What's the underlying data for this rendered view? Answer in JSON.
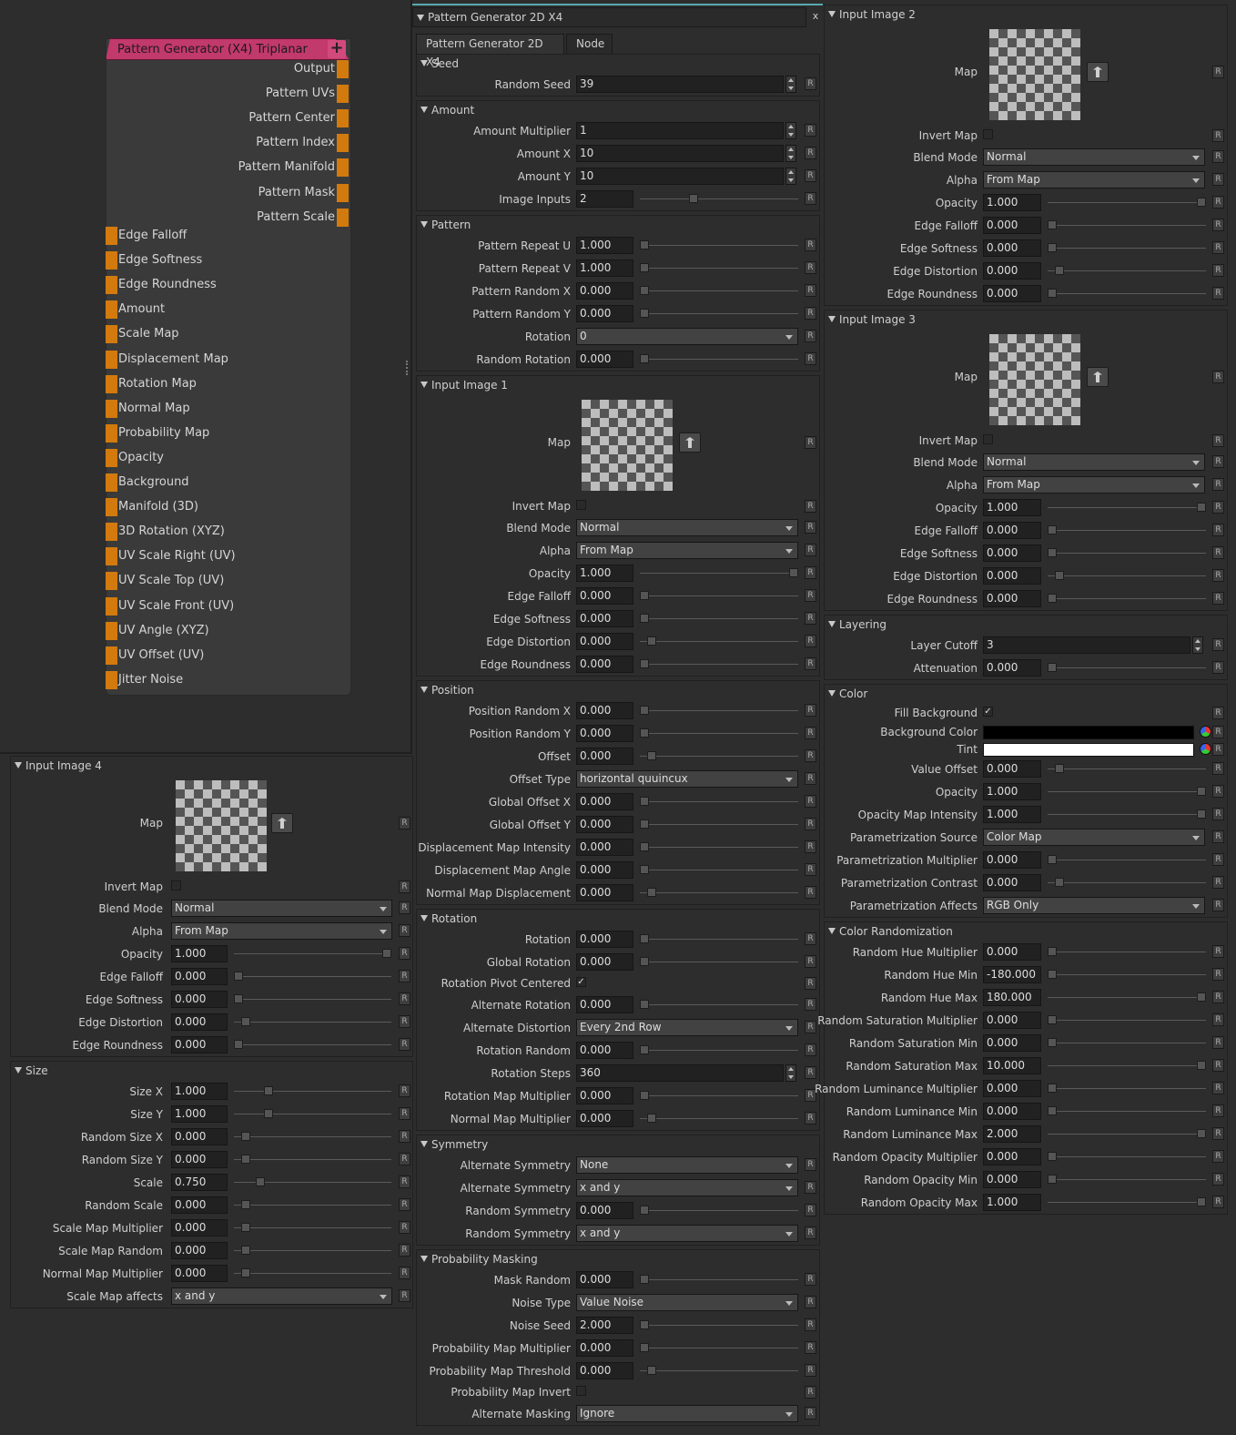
{
  "node": {
    "title": "Pattern Generator (X4) Triplanar",
    "add_label": "+",
    "outputs": [
      "Output",
      "Pattern UVs",
      "Pattern Center",
      "Pattern Index",
      "Pattern Manifold",
      "Pattern Mask",
      "Pattern Scale"
    ],
    "inputs": [
      "Edge Falloff",
      "Edge Softness",
      "Edge Roundness",
      "Amount",
      "Scale Map",
      "Displacement Map",
      "Rotation Map",
      "Normal Map",
      "Probability Map",
      "Opacity",
      "Background",
      "Manifold (3D)",
      "3D Rotation (XYZ)",
      "UV Scale Right (UV)",
      "UV Scale Top (UV)",
      "UV Scale Front (UV)",
      "UV Angle (XYZ)",
      "UV Offset (UV)",
      "Jitter Noise"
    ]
  },
  "panel": {
    "title": "Pattern Generator 2D X4",
    "close": "x",
    "tabs": [
      "Pattern Generator 2D X4",
      "Node"
    ],
    "reset": "R"
  },
  "col_left": [
    {
      "title": "Input Image 4",
      "rows": [
        {
          "t": "map",
          "label": "Map"
        },
        {
          "t": "chk",
          "label": "Invert Map",
          "checked": false
        },
        {
          "t": "dd",
          "label": "Blend Mode",
          "value": "Normal"
        },
        {
          "t": "dd",
          "label": "Alpha",
          "value": "From Map"
        },
        {
          "t": "sl",
          "label": "Opacity",
          "value": "1.000",
          "pos": 1
        },
        {
          "t": "sl",
          "label": "Edge Falloff",
          "value": "0.000",
          "pos": 0
        },
        {
          "t": "sl",
          "label": "Edge Softness",
          "value": "0.000",
          "pos": 0
        },
        {
          "t": "sl",
          "label": "Edge Distortion",
          "value": "0.000",
          "pos": 0.5,
          "center": true
        },
        {
          "t": "sl",
          "label": "Edge Roundness",
          "value": "0.000",
          "pos": 0
        }
      ]
    },
    {
      "title": "Size",
      "rows": [
        {
          "t": "sl",
          "label": "Size X",
          "value": "1.000",
          "pos": 0.2
        },
        {
          "t": "sl",
          "label": "Size Y",
          "value": "1.000",
          "pos": 0.2
        },
        {
          "t": "sl",
          "label": "Random Size X",
          "value": "0.000",
          "pos": 0.5,
          "center": true
        },
        {
          "t": "sl",
          "label": "Random Size Y",
          "value": "0.000",
          "pos": 0.5,
          "center": true
        },
        {
          "t": "sl",
          "label": "Scale",
          "value": "0.750",
          "pos": 0.15
        },
        {
          "t": "sl",
          "label": "Random Scale",
          "value": "0.000",
          "pos": 0.5,
          "center": true
        },
        {
          "t": "sl",
          "label": "Scale Map Multiplier",
          "value": "0.000",
          "pos": 0.5,
          "center": true
        },
        {
          "t": "sl",
          "label": "Scale Map Random",
          "value": "0.000",
          "pos": 0.5,
          "center": true
        },
        {
          "t": "sl",
          "label": "Normal Map Multiplier",
          "value": "0.000",
          "pos": 0.5,
          "center": true
        },
        {
          "t": "dd",
          "label": "Scale Map affects",
          "value": "x and y"
        }
      ]
    }
  ],
  "col_mid": [
    {
      "title": "Seed",
      "rows": [
        {
          "t": "num",
          "label": "Random Seed",
          "value": "39"
        }
      ]
    },
    {
      "title": "Amount",
      "rows": [
        {
          "t": "num",
          "label": "Amount Multiplier",
          "value": "1"
        },
        {
          "t": "num",
          "label": "Amount X",
          "value": "10"
        },
        {
          "t": "num",
          "label": "Amount Y",
          "value": "10"
        },
        {
          "t": "sl",
          "label": "Image Inputs",
          "value": "2",
          "pos": 0.33
        }
      ]
    },
    {
      "title": "Pattern",
      "rows": [
        {
          "t": "sl",
          "label": "Pattern Repeat U",
          "value": "1.000",
          "pos": 0
        },
        {
          "t": "sl",
          "label": "Pattern Repeat V",
          "value": "1.000",
          "pos": 0
        },
        {
          "t": "sl",
          "label": "Pattern Random X",
          "value": "0.000",
          "pos": 0
        },
        {
          "t": "sl",
          "label": "Pattern Random Y",
          "value": "0.000",
          "pos": 0
        },
        {
          "t": "dd",
          "label": "Rotation",
          "value": "0"
        },
        {
          "t": "sl",
          "label": "Random Rotation",
          "value": "0.000",
          "pos": 0
        }
      ]
    },
    {
      "title": "Input Image 1",
      "rows": [
        {
          "t": "map",
          "label": "Map"
        },
        {
          "t": "chk",
          "label": "Invert Map",
          "checked": false
        },
        {
          "t": "dd",
          "label": "Blend Mode",
          "value": "Normal"
        },
        {
          "t": "dd",
          "label": "Alpha",
          "value": "From Map"
        },
        {
          "t": "sl",
          "label": "Opacity",
          "value": "1.000",
          "pos": 1
        },
        {
          "t": "sl",
          "label": "Edge Falloff",
          "value": "0.000",
          "pos": 0
        },
        {
          "t": "sl",
          "label": "Edge Softness",
          "value": "0.000",
          "pos": 0
        },
        {
          "t": "sl",
          "label": "Edge Distortion",
          "value": "0.000",
          "pos": 0.5,
          "center": true
        },
        {
          "t": "sl",
          "label": "Edge Roundness",
          "value": "0.000",
          "pos": 0
        }
      ]
    },
    {
      "title": "Position",
      "rows": [
        {
          "t": "sl",
          "label": "Position Random X",
          "value": "0.000",
          "pos": 0
        },
        {
          "t": "sl",
          "label": "Position Random Y",
          "value": "0.000",
          "pos": 0
        },
        {
          "t": "sl",
          "label": "Offset",
          "value": "0.000",
          "pos": 0.5,
          "center": true
        },
        {
          "t": "dd",
          "label": "Offset Type",
          "value": "horizontal quuincux"
        },
        {
          "t": "sl",
          "label": "Global Offset X",
          "value": "0.000",
          "pos": 0
        },
        {
          "t": "sl",
          "label": "Global Offset Y",
          "value": "0.000",
          "pos": 0
        },
        {
          "t": "sl",
          "label": "Displacement Map Intensity",
          "value": "0.000",
          "pos": 0
        },
        {
          "t": "sl",
          "label": "Displacement Map Angle",
          "value": "0.000",
          "pos": 0
        },
        {
          "t": "sl",
          "label": "Normal Map Displacement",
          "value": "0.000",
          "pos": 0.5,
          "center": true
        }
      ]
    },
    {
      "title": "Rotation",
      "rows": [
        {
          "t": "sl",
          "label": "Rotation",
          "value": "0.000",
          "pos": 0
        },
        {
          "t": "sl",
          "label": "Global Rotation",
          "value": "0.000",
          "pos": 0
        },
        {
          "t": "chk",
          "label": "Rotation Pivot Centered",
          "checked": true
        },
        {
          "t": "sl",
          "label": "Alternate Rotation",
          "value": "0.000",
          "pos": 0
        },
        {
          "t": "dd",
          "label": "Alternate Distortion",
          "value": "Every 2nd Row"
        },
        {
          "t": "sl",
          "label": "Rotation Random",
          "value": "0.000",
          "pos": 0
        },
        {
          "t": "num",
          "label": "Rotation Steps",
          "value": "360"
        },
        {
          "t": "sl",
          "label": "Rotation Map Multiplier",
          "value": "0.000",
          "pos": 0
        },
        {
          "t": "sl",
          "label": "Normal Map Multiplier",
          "value": "0.000",
          "pos": 0.5,
          "center": true
        }
      ]
    },
    {
      "title": "Symmetry",
      "rows": [
        {
          "t": "dd",
          "label": "Alternate Symmetry",
          "value": "None"
        },
        {
          "t": "dd",
          "label": "Alternate Symmetry",
          "value": "x and y"
        },
        {
          "t": "sl",
          "label": "Random Symmetry",
          "value": "0.000",
          "pos": 0
        },
        {
          "t": "dd",
          "label": "Random Symmetry",
          "value": "x and y"
        }
      ]
    },
    {
      "title": "Probability Masking",
      "rows": [
        {
          "t": "sl",
          "label": "Mask Random",
          "value": "0.000",
          "pos": 0
        },
        {
          "t": "dd",
          "label": "Noise Type",
          "value": "Value Noise"
        },
        {
          "t": "sl",
          "label": "Noise Seed",
          "value": "2.000",
          "pos": 0
        },
        {
          "t": "sl",
          "label": "Probability Map Multiplier",
          "value": "0.000",
          "pos": 0
        },
        {
          "t": "sl",
          "label": "Probability Map Threshold",
          "value": "0.000",
          "pos": 0.5,
          "center": true
        },
        {
          "t": "chk",
          "label": "Probability Map Invert",
          "checked": false
        },
        {
          "t": "dd",
          "label": "Alternate Masking",
          "value": "Ignore"
        }
      ]
    }
  ],
  "col_right": [
    {
      "title": "Input Image 2",
      "rows": [
        {
          "t": "map",
          "label": "Map"
        },
        {
          "t": "chk",
          "label": "Invert Map",
          "checked": false
        },
        {
          "t": "dd",
          "label": "Blend Mode",
          "value": "Normal"
        },
        {
          "t": "dd",
          "label": "Alpha",
          "value": "From Map"
        },
        {
          "t": "sl",
          "label": "Opacity",
          "value": "1.000",
          "pos": 1
        },
        {
          "t": "sl",
          "label": "Edge Falloff",
          "value": "0.000",
          "pos": 0
        },
        {
          "t": "sl",
          "label": "Edge Softness",
          "value": "0.000",
          "pos": 0
        },
        {
          "t": "sl",
          "label": "Edge Distortion",
          "value": "0.000",
          "pos": 0.5,
          "center": true
        },
        {
          "t": "sl",
          "label": "Edge Roundness",
          "value": "0.000",
          "pos": 0
        }
      ]
    },
    {
      "title": "Input Image 3",
      "rows": [
        {
          "t": "map",
          "label": "Map"
        },
        {
          "t": "chk",
          "label": "Invert Map",
          "checked": false
        },
        {
          "t": "dd",
          "label": "Blend Mode",
          "value": "Normal"
        },
        {
          "t": "dd",
          "label": "Alpha",
          "value": "From Map"
        },
        {
          "t": "sl",
          "label": "Opacity",
          "value": "1.000",
          "pos": 1
        },
        {
          "t": "sl",
          "label": "Edge Falloff",
          "value": "0.000",
          "pos": 0
        },
        {
          "t": "sl",
          "label": "Edge Softness",
          "value": "0.000",
          "pos": 0
        },
        {
          "t": "sl",
          "label": "Edge Distortion",
          "value": "0.000",
          "pos": 0.5,
          "center": true
        },
        {
          "t": "sl",
          "label": "Edge Roundness",
          "value": "0.000",
          "pos": 0
        }
      ]
    },
    {
      "title": "Layering",
      "rows": [
        {
          "t": "num",
          "label": "Layer Cutoff",
          "value": "3"
        },
        {
          "t": "sl",
          "label": "Attenuation",
          "value": "0.000",
          "pos": 0
        }
      ]
    },
    {
      "title": "Color",
      "rows": [
        {
          "t": "chk",
          "label": "Fill Background",
          "checked": true,
          "short": true
        },
        {
          "t": "color",
          "label": "Background Color",
          "color": "#000000"
        },
        {
          "t": "color",
          "label": "Tint",
          "color": "#ffffff"
        },
        {
          "t": "sl",
          "label": "Value Offset",
          "value": "0.000",
          "pos": 0.5,
          "center": true
        },
        {
          "t": "sl",
          "label": "Opacity",
          "value": "1.000",
          "pos": 1
        },
        {
          "t": "sl",
          "label": "Opacity Map Intensity",
          "value": "1.000",
          "pos": 1
        },
        {
          "t": "dd",
          "label": "Parametrization Source",
          "value": "Color Map"
        },
        {
          "t": "sl",
          "label": "Parametrization Multiplier",
          "value": "0.000",
          "pos": 0
        },
        {
          "t": "sl",
          "label": "Parametrization Contrast",
          "value": "0.000",
          "pos": 0.5,
          "center": true
        },
        {
          "t": "dd",
          "label": "Parametrization Affects",
          "value": "RGB Only"
        }
      ]
    },
    {
      "title": "Color Randomization",
      "rows": [
        {
          "t": "sl",
          "label": "Random Hue Multiplier",
          "value": "0.000",
          "pos": 0
        },
        {
          "t": "sl",
          "label": "Random Hue Min",
          "value": "-180.000",
          "pos": 0
        },
        {
          "t": "sl",
          "label": "Random Hue Max",
          "value": "180.000",
          "pos": 1
        },
        {
          "t": "sl",
          "label": "Random Saturation Multiplier",
          "value": "0.000",
          "pos": 0
        },
        {
          "t": "sl",
          "label": "Random Saturation Min",
          "value": "0.000",
          "pos": 0
        },
        {
          "t": "sl",
          "label": "Random Saturation Max",
          "value": "10.000",
          "pos": 1
        },
        {
          "t": "sl",
          "label": "Random Luminance Multiplier",
          "value": "0.000",
          "pos": 0
        },
        {
          "t": "sl",
          "label": "Random Luminance Min",
          "value": "0.000",
          "pos": 0
        },
        {
          "t": "sl",
          "label": "Random Luminance Max",
          "value": "2.000",
          "pos": 1
        },
        {
          "t": "sl",
          "label": "Random Opacity Multiplier",
          "value": "0.000",
          "pos": 0
        },
        {
          "t": "sl",
          "label": "Random Opacity Min",
          "value": "0.000",
          "pos": 0
        },
        {
          "t": "sl",
          "label": "Random Opacity Max",
          "value": "1.000",
          "pos": 1
        }
      ]
    }
  ]
}
